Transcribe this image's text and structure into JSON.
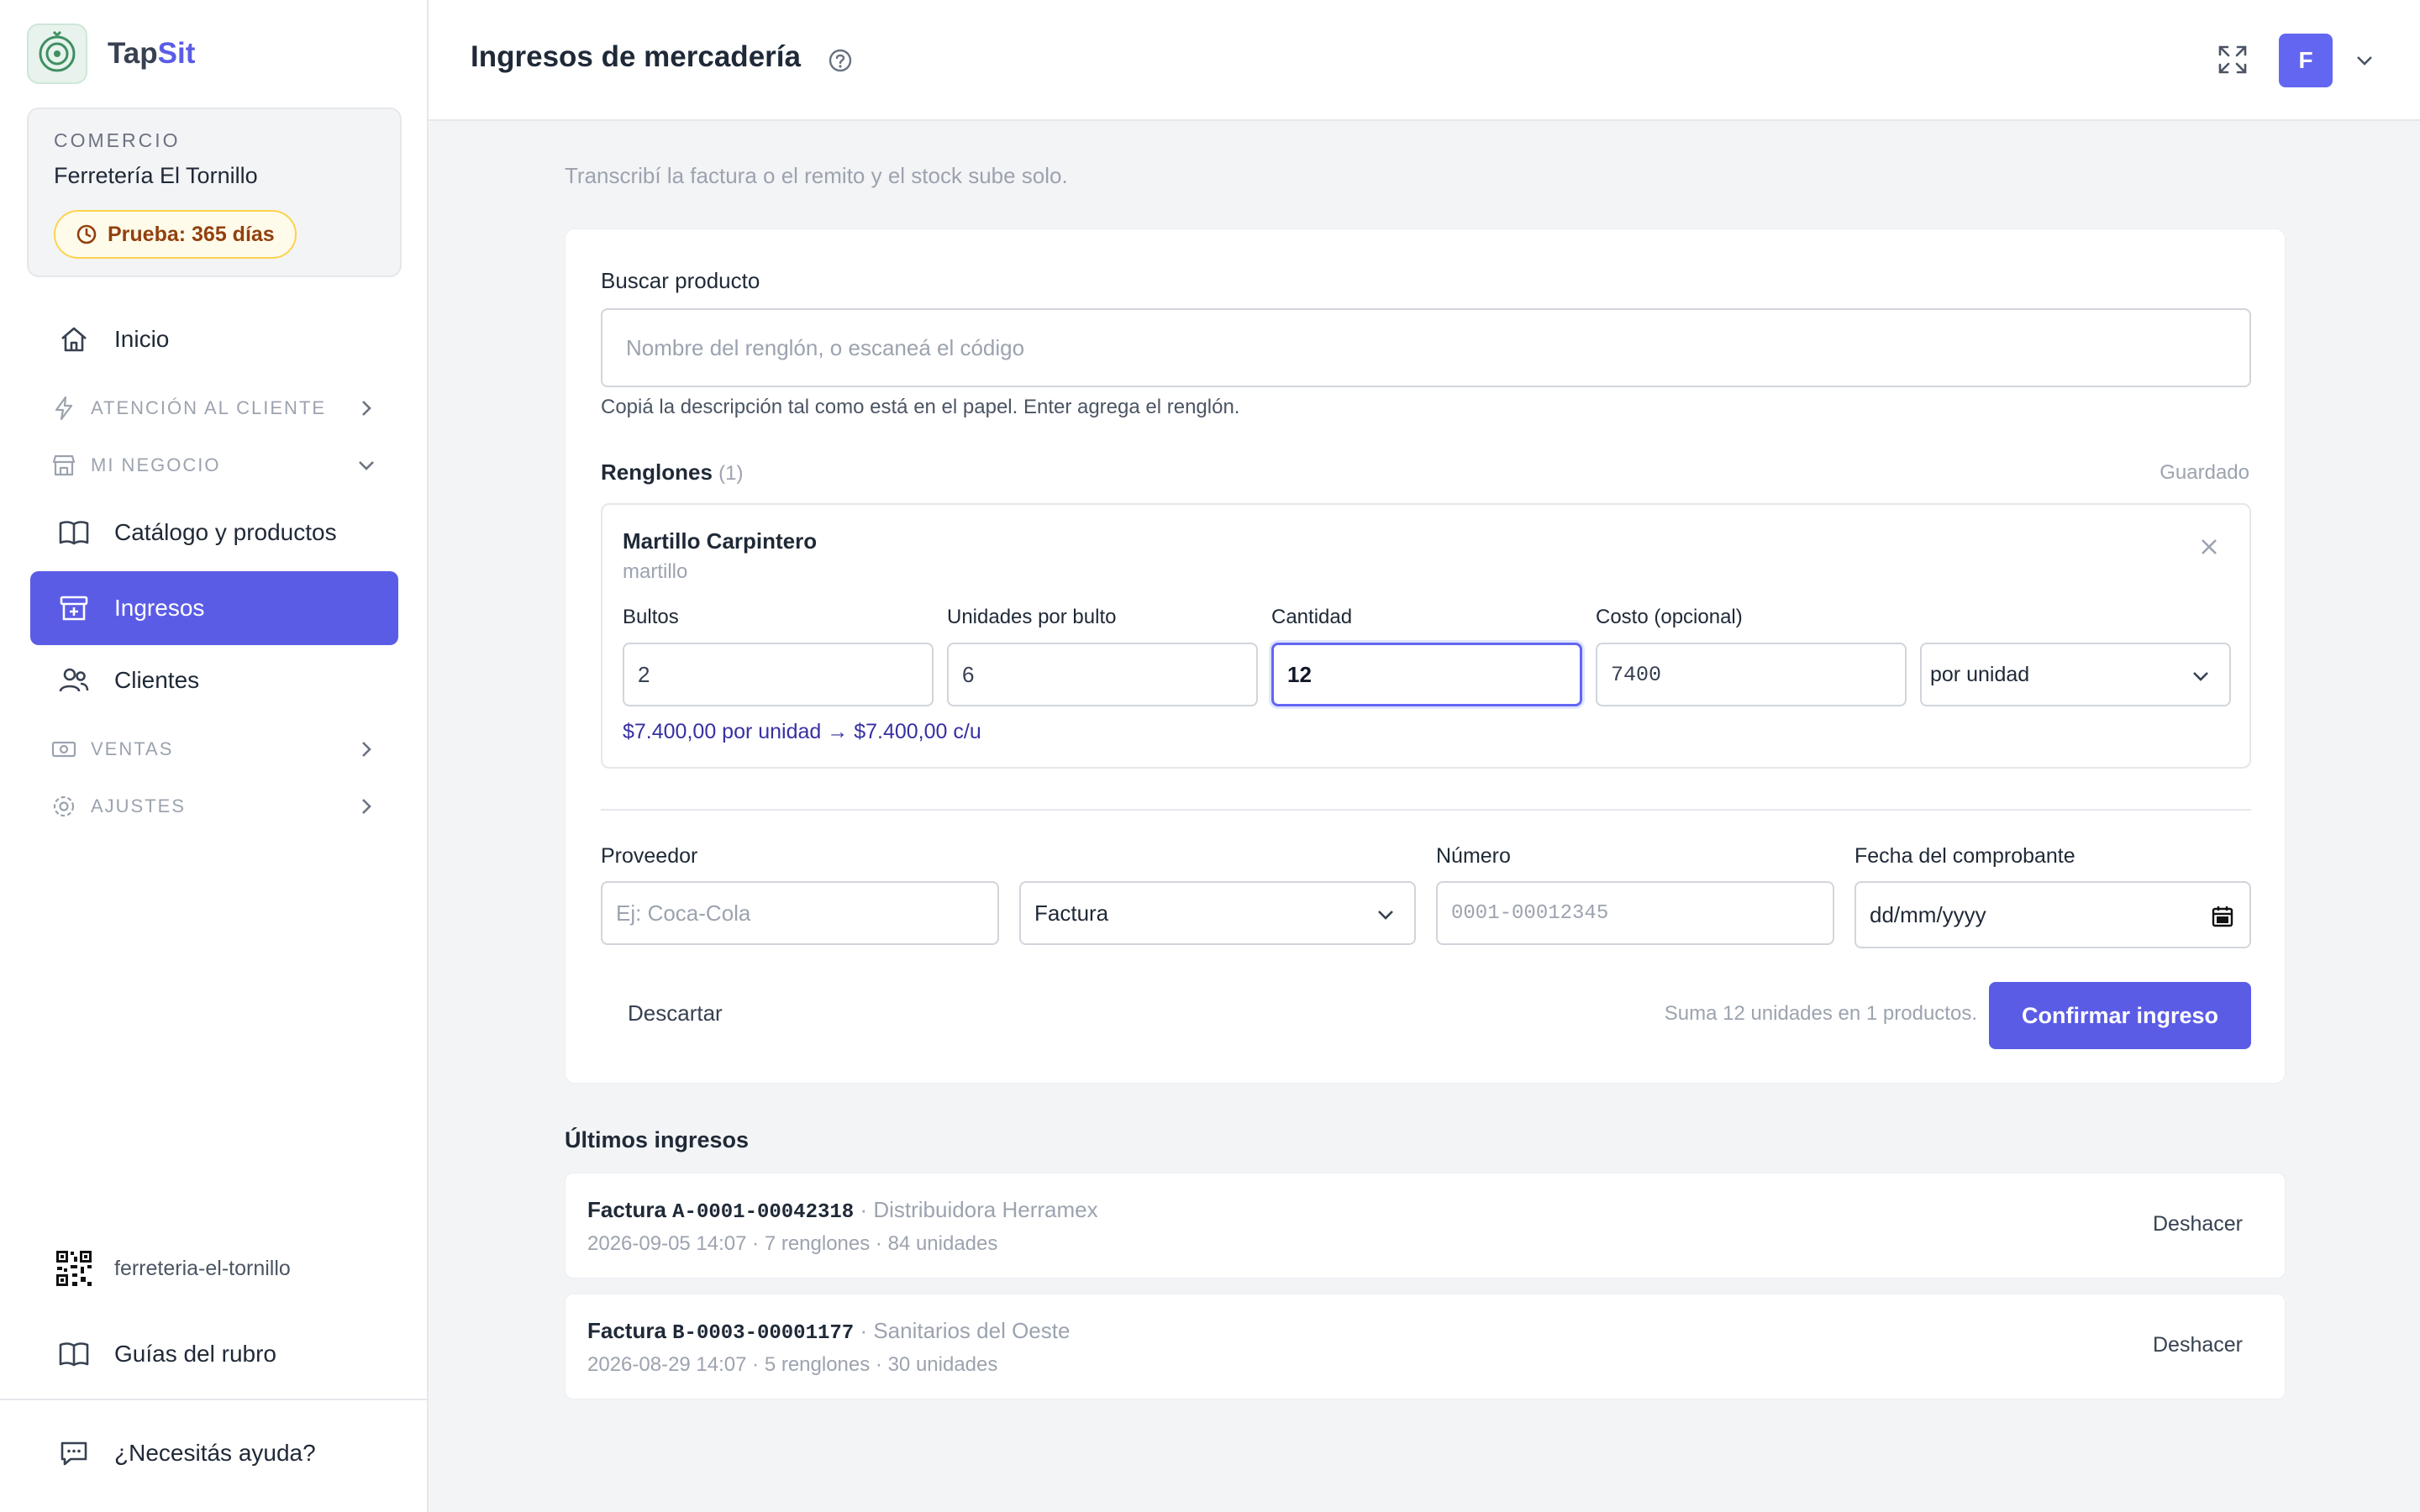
{
  "brand": {
    "name_part1": "Tap",
    "name_part2": "Sit"
  },
  "store": {
    "label": "COMERCIO",
    "name": "Ferretería El Tornillo",
    "trial": "Prueba: 365 días"
  },
  "nav": {
    "home": "Inicio",
    "section_customer": "ATENCIÓN AL CLIENTE",
    "section_business": "MI NEGOCIO",
    "catalog": "Catálogo y productos",
    "incomes": "Ingresos",
    "clients": "Clientes",
    "section_sales": "VENTAS",
    "section_settings": "AJUSTES",
    "slug": "ferreteria-el-tornillo",
    "guides": "Guías del rubro",
    "help": "¿Necesitás ayuda?"
  },
  "header": {
    "title": "Ingresos de mercadería",
    "avatar_letter": "F"
  },
  "subtitle": "Transcribí la factura o el remito y el stock sube solo.",
  "search": {
    "label": "Buscar producto",
    "placeholder": "Nombre del renglón, o escaneá el código",
    "hint": "Copiá la descripción tal como está en el papel. Enter agrega el renglón."
  },
  "lines": {
    "title": "Renglones",
    "count": "(1)",
    "status": "Guardado",
    "items": [
      {
        "name": "Martillo Carpintero",
        "query": "martillo",
        "bultos_label": "Bultos",
        "bultos": "2",
        "units_label": "Unidades por bulto",
        "units": "6",
        "qty_label": "Cantidad",
        "qty": "12",
        "cost_label": "Costo (opcional)",
        "cost": "7400",
        "cost_mode": "por unidad",
        "summary": "$7.400,00 por unidad → $7.400,00 c/u"
      }
    ]
  },
  "form": {
    "supplier_label": "Proveedor",
    "supplier_placeholder": "Ej: Coca-Cola",
    "doc_type": "Factura",
    "number_label": "Número",
    "number_placeholder": "0001-00012345",
    "date_label": "Fecha del comprobante",
    "date_value": "dd/mm/yyyy",
    "discard": "Descartar",
    "total_summary": "Suma 12 unidades en 1 productos.",
    "confirm": "Confirmar ingreso"
  },
  "recent": {
    "title": "Últimos ingresos",
    "items": [
      {
        "type": "Factura",
        "code": "A-0001-00042318",
        "vendor": "· Distribuidora Herramex",
        "meta": "2026-09-05 14:07 · 7 renglones · 84 unidades",
        "undo": "Deshacer"
      },
      {
        "type": "Factura",
        "code": "B-0003-00001177",
        "vendor": "· Sanitarios del Oeste",
        "meta": "2026-08-29 14:07 · 5 renglones · 30 unidades",
        "undo": "Deshacer"
      }
    ]
  },
  "colors": {
    "accent": "#5b5ce6",
    "trial_bg": "#fffbeb",
    "trial_text": "#92400e"
  }
}
